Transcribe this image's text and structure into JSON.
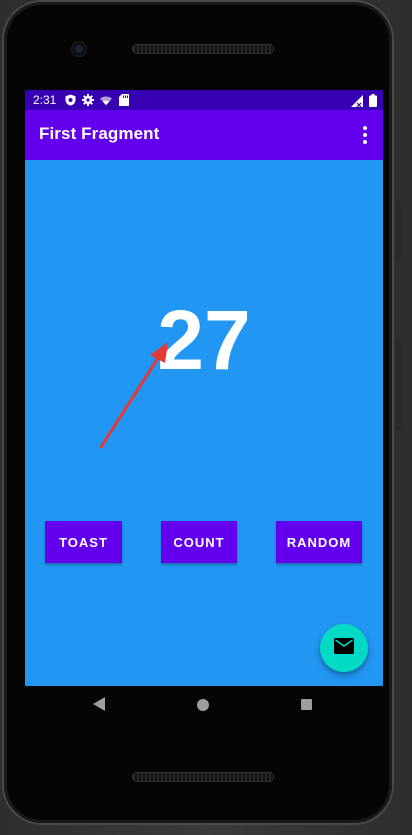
{
  "status_bar": {
    "time": "2:31",
    "icons": [
      "shield-icon",
      "gear-icon",
      "wifi-icon",
      "sd-card-icon"
    ],
    "right_icons": [
      "signal-icon",
      "battery-icon"
    ]
  },
  "app_bar": {
    "title": "First Fragment",
    "overflow_icon": "more-vert-icon"
  },
  "main": {
    "count_value": "27",
    "buttons": {
      "toast": "TOAST",
      "count": "COUNT",
      "random": "RANDOM"
    },
    "fab_icon": "mail-icon"
  },
  "nav_bar": {
    "icons": [
      "back-icon",
      "home-icon",
      "recents-icon"
    ]
  },
  "colors": {
    "status_bar": "#3700b3",
    "app_bar": "#6200ee",
    "background": "#2196f3",
    "button": "#6200ee",
    "fab": "#03dac5",
    "annotation_arrow": "#e53935"
  }
}
